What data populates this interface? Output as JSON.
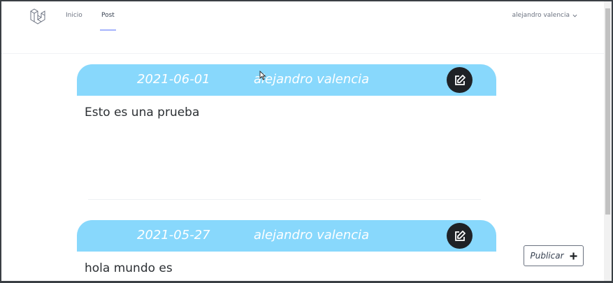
{
  "nav": {
    "links": [
      {
        "label": "Inicio",
        "active": false
      },
      {
        "label": "Post",
        "active": true
      }
    ],
    "user": "alejandro valencia",
    "logo_icon": "laravel-logo-icon"
  },
  "posts": [
    {
      "date": "2021-06-01",
      "author": "alejandro valencia",
      "body": "Esto es una prueba"
    },
    {
      "date": "2021-05-27",
      "author": "alejandro valencia",
      "body": "hola mundo es"
    }
  ],
  "publish_button": {
    "label": "Publicar",
    "icon": "plus-icon"
  },
  "colors": {
    "post_header": "#88d8fc",
    "edit_button": "#1f2226",
    "nav_active_underline": "#a5b4fc"
  }
}
